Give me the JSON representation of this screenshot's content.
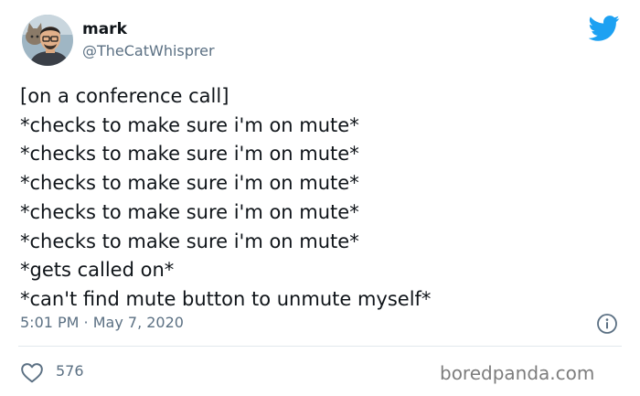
{
  "theme": {
    "text_color": "#0f1419",
    "secondary_color": "#5b7083",
    "brand_color": "#1da1f2",
    "divider_color": "#e1e8ed"
  },
  "author": {
    "name": "mark",
    "handle": "@TheCatWhisprer",
    "avatar_icon": "avatar-man-with-cat"
  },
  "brand_icon": "twitter-bird-icon",
  "tweet": {
    "lines": [
      "[on a conference call]",
      "*checks to make sure i'm on mute*",
      "*checks to make sure i'm on mute*",
      "*checks to make sure i'm on mute*",
      "*checks to make sure i'm on mute*",
      "*checks to make sure i'm on mute*",
      "*gets called on*",
      "*can't find mute button to unmute myself*"
    ],
    "timestamp": "5:01 PM · May 7, 2020"
  },
  "actions": {
    "like_icon": "heart-icon",
    "like_count": "576",
    "info_icon": "info-icon"
  },
  "watermark": "boredpanda.com"
}
